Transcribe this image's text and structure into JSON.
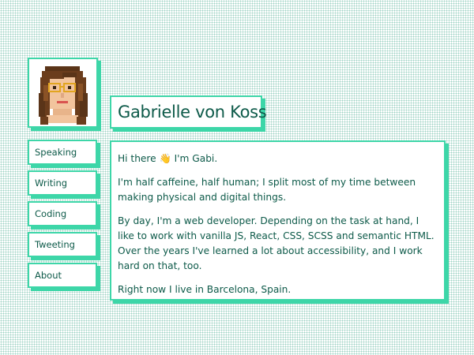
{
  "profile": {
    "name": "Gabrielle von Koss"
  },
  "nav": {
    "items": [
      {
        "label": "Speaking"
      },
      {
        "label": "Writing"
      },
      {
        "label": "Coding"
      },
      {
        "label": "Tweeting"
      },
      {
        "label": "About"
      }
    ]
  },
  "content": {
    "paragraphs": [
      "Hi there 👋 I'm Gabi.",
      "I'm half caffeine, half human; I split most of my time between making physical and digital things.",
      "By day, I'm a web developer. Depending on the task at hand, I like to work with vanilla JS, React, CSS, SCSS and semantic HTML. Over the years I've learned a lot about accessibility, and I work hard on that, too.",
      "Right now I live in Barcelona, Spain."
    ]
  },
  "colors": {
    "accent": "#3dd6a8",
    "text": "#0d5a49",
    "background_dots": "#9fd3c4"
  }
}
